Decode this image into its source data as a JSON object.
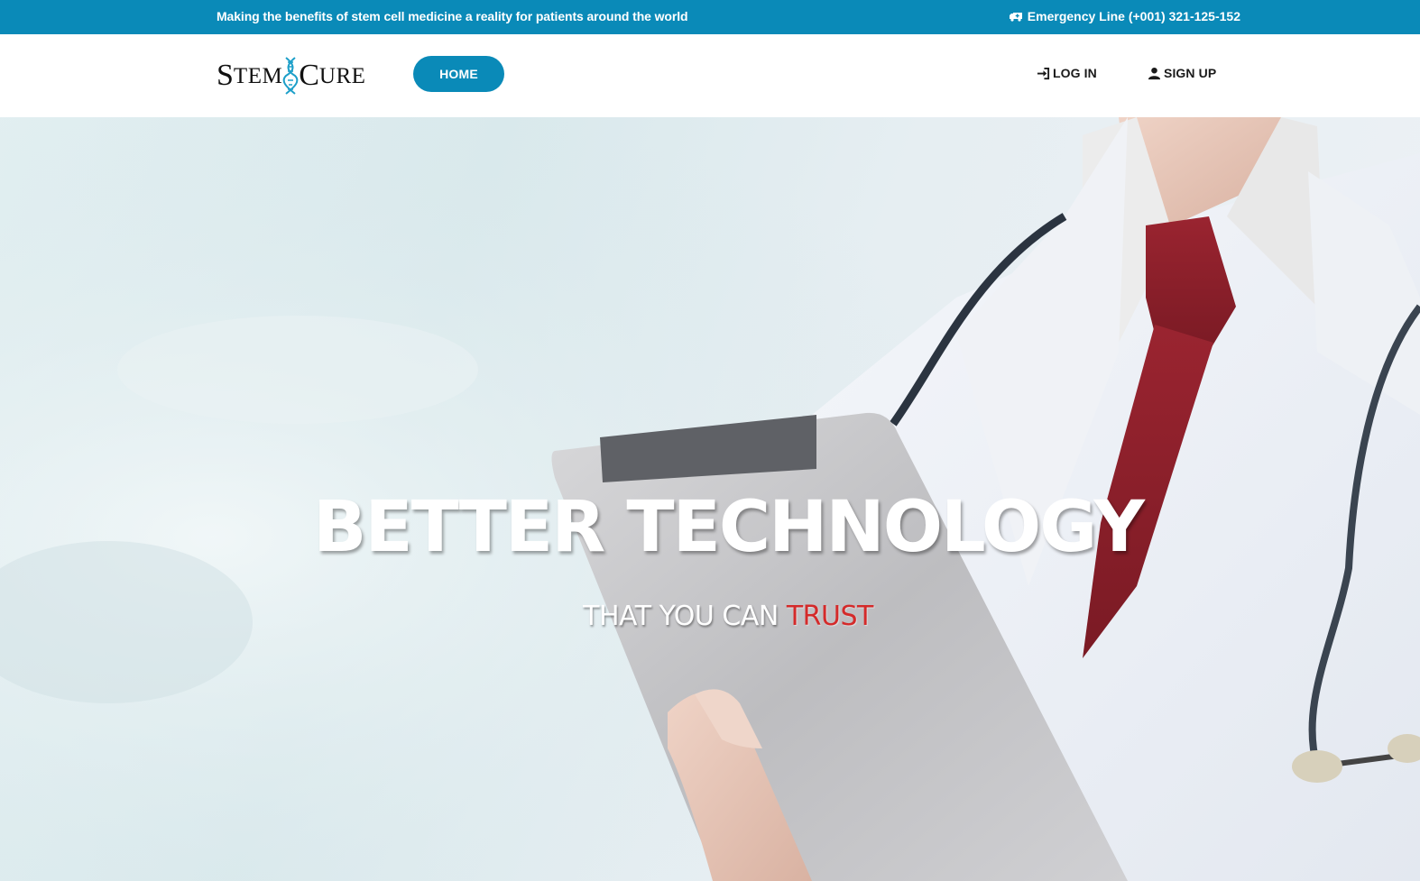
{
  "topbar": {
    "tagline": "Making the benefits of stem cell medicine a reality for patients around the world",
    "emergency": "Emergency Line (+001) 321-125-152",
    "emergency_icon": "ambulance-icon"
  },
  "logo": {
    "part1_initial": "S",
    "part1_rest": "TEM",
    "part2_initial": "C",
    "part2_rest": "URE",
    "icon": "dna-icon"
  },
  "nav": {
    "home": "HOME",
    "login": "LOG IN",
    "login_icon": "sign-in-icon",
    "signup": "SIGN UP",
    "signup_icon": "user-icon"
  },
  "hero": {
    "title": "BETTER TECHNOLOGY",
    "subtitle_lead": "THAT YOU CAN ",
    "subtitle_accent": "TRUST"
  },
  "colors": {
    "brand": "#0a8ab8",
    "accent": "#d42a2a"
  }
}
